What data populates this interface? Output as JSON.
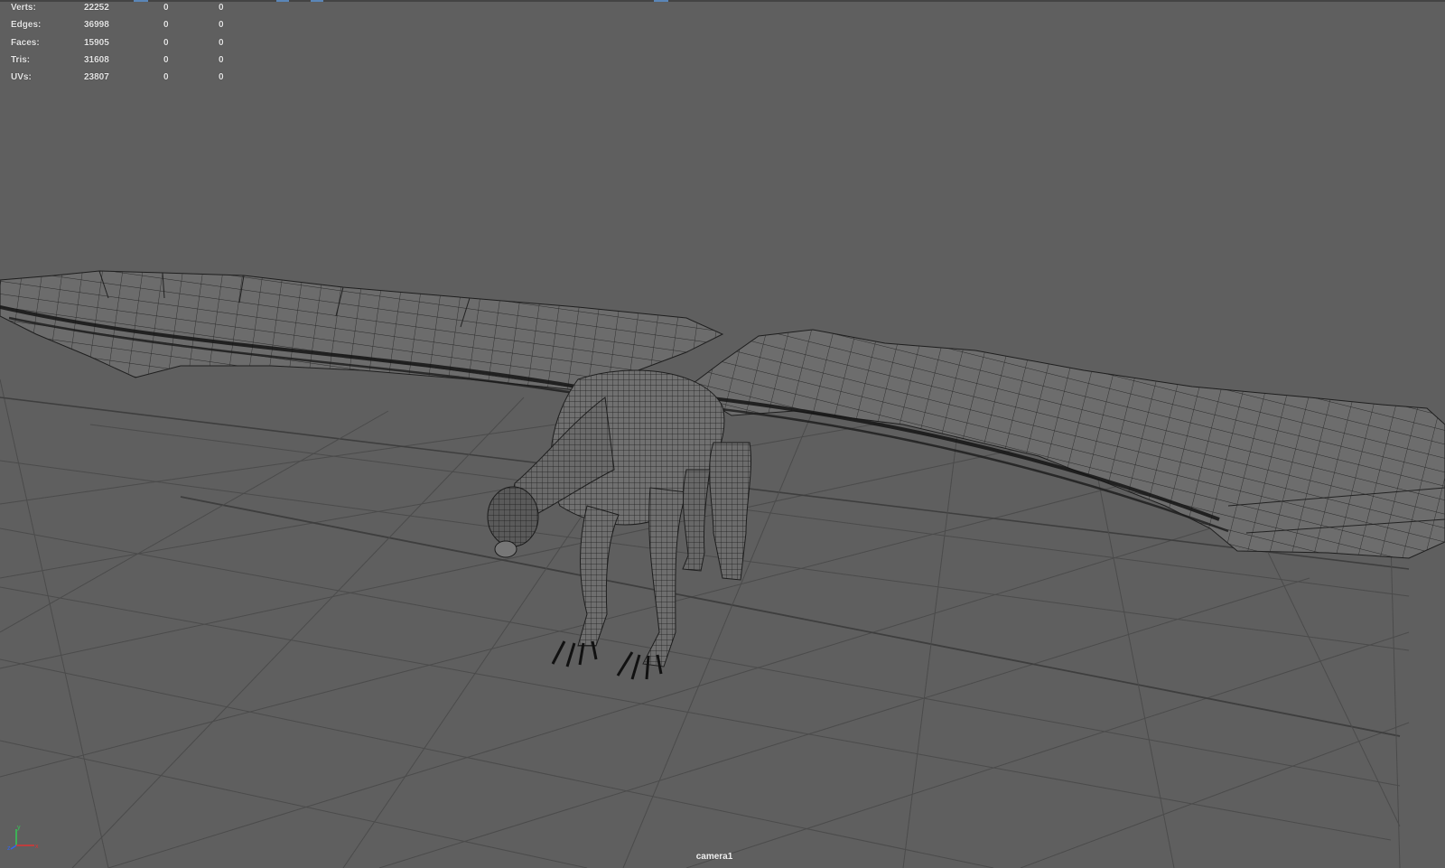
{
  "hud": {
    "rows": [
      {
        "label": "Verts:",
        "v1": "22252",
        "v2": "0",
        "v3": "0"
      },
      {
        "label": "Edges:",
        "v1": "36998",
        "v2": "0",
        "v3": "0"
      },
      {
        "label": "Faces:",
        "v1": "15905",
        "v2": "0",
        "v3": "0"
      },
      {
        "label": "Tris:",
        "v1": "31608",
        "v2": "0",
        "v3": "0"
      },
      {
        "label": "UVs:",
        "v1": "23807",
        "v2": "0",
        "v3": "0"
      }
    ]
  },
  "viewport": {
    "camera_label": "camera1",
    "background_color": "#5f5f5f",
    "grid_color": "#4a4a4a",
    "wire_color": "#1e1e1e"
  },
  "axis_indicator": {
    "x_label": "x",
    "y_label": "y",
    "z_label": "z"
  }
}
